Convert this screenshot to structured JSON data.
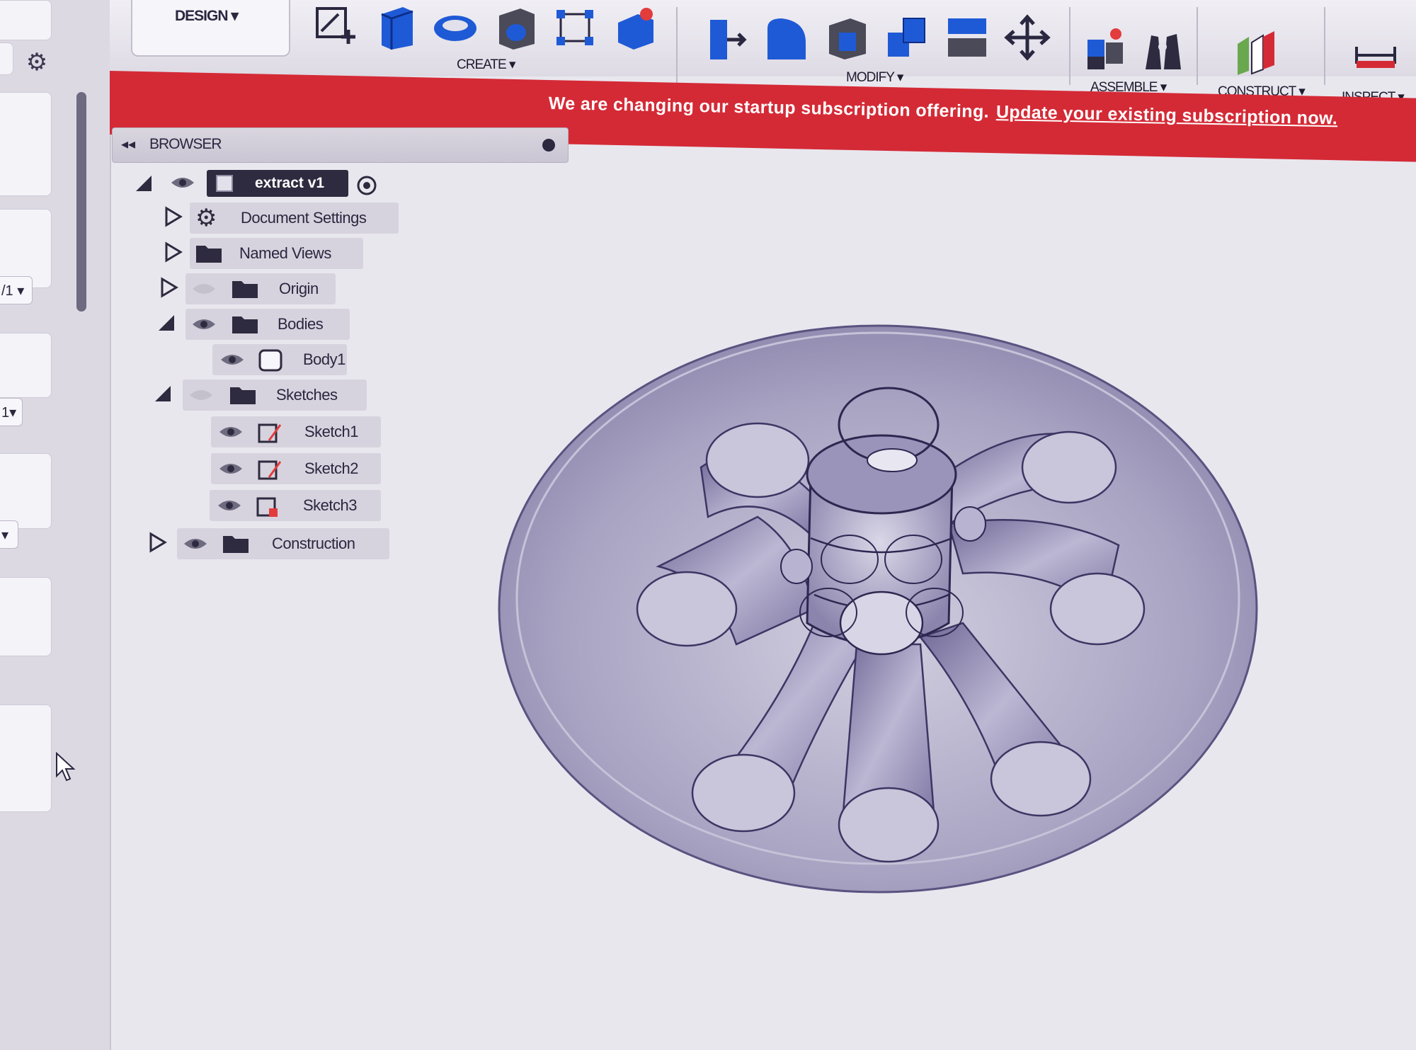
{
  "toolbar": {
    "workspace_label": "DESIGN",
    "groups": [
      {
        "label": "CREATE",
        "icons": [
          "create-sketch-icon",
          "extrude-icon",
          "revolve-icon",
          "hole-icon",
          "pattern-icon",
          "create-form-icon"
        ]
      },
      {
        "label": "MODIFY",
        "icons": [
          "press-pull-icon",
          "fillet-icon",
          "shell-icon",
          "combine-icon",
          "split-body-icon",
          "move-icon"
        ]
      },
      {
        "label": "ASSEMBLE",
        "icons": [
          "new-component-icon",
          "joint-icon"
        ]
      },
      {
        "label": "CONSTRUCT",
        "icons": [
          "offset-plane-icon"
        ]
      },
      {
        "label": "INSPECT",
        "icons": [
          "measure-icon"
        ]
      }
    ]
  },
  "banner": {
    "message": "We are changing our startup subscription offering.",
    "link_text": "Update your existing subscription now.",
    "color": "#d42a36"
  },
  "browser": {
    "title": "BROWSER",
    "root": {
      "label": "extract v1"
    },
    "items": [
      {
        "label": "Document Settings",
        "icon": "gear-icon",
        "expanded": false
      },
      {
        "label": "Named Views",
        "icon": "folder-icon",
        "expanded": false
      },
      {
        "label": "Origin",
        "icon": "folder-icon",
        "expanded": false,
        "hidden": true
      },
      {
        "label": "Bodies",
        "icon": "folder-icon",
        "expanded": true
      },
      {
        "label": "Body1",
        "icon": "body-icon"
      },
      {
        "label": "Sketches",
        "icon": "folder-icon",
        "expanded": true,
        "hidden": true
      },
      {
        "label": "Sketch1",
        "icon": "sketch-icon"
      },
      {
        "label": "Sketch2",
        "icon": "sketch-icon"
      },
      {
        "label": "Sketch3",
        "icon": "sketch-icon"
      },
      {
        "label": "Construction",
        "icon": "folder-icon",
        "expanded": false
      }
    ]
  },
  "left_strip": {
    "select_values": [
      "/1",
      "1"
    ]
  }
}
